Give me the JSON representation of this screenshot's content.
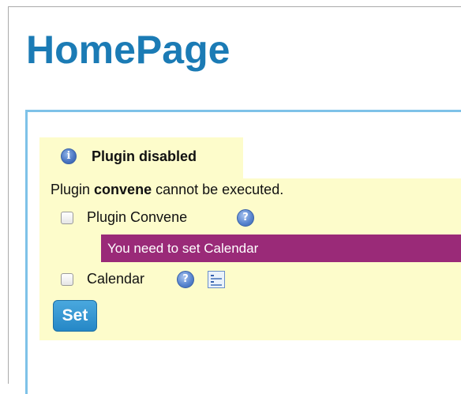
{
  "page": {
    "title": "HomePage"
  },
  "plugin_box": {
    "tab_title": "Plugin disabled",
    "message_prefix": "Plugin ",
    "plugin_name": "convene",
    "message_suffix": " cannot be executed.",
    "fields": [
      {
        "label": "Plugin Convene",
        "checked": false,
        "help_icon": "help-icon"
      },
      {
        "label": "Calendar",
        "checked": false,
        "help_icon": "help-icon",
        "extra_icon": "calendar-list-icon"
      }
    ],
    "warning": "You need to set Calendar",
    "submit_label": "Set"
  },
  "colors": {
    "title": "#1b7bb5",
    "box_background": "#fdfccb",
    "box_border": "#7ec2e8",
    "warning_background": "#9a2a78",
    "button": "#2587c6"
  },
  "icons": {
    "info": "i",
    "help": "?"
  }
}
